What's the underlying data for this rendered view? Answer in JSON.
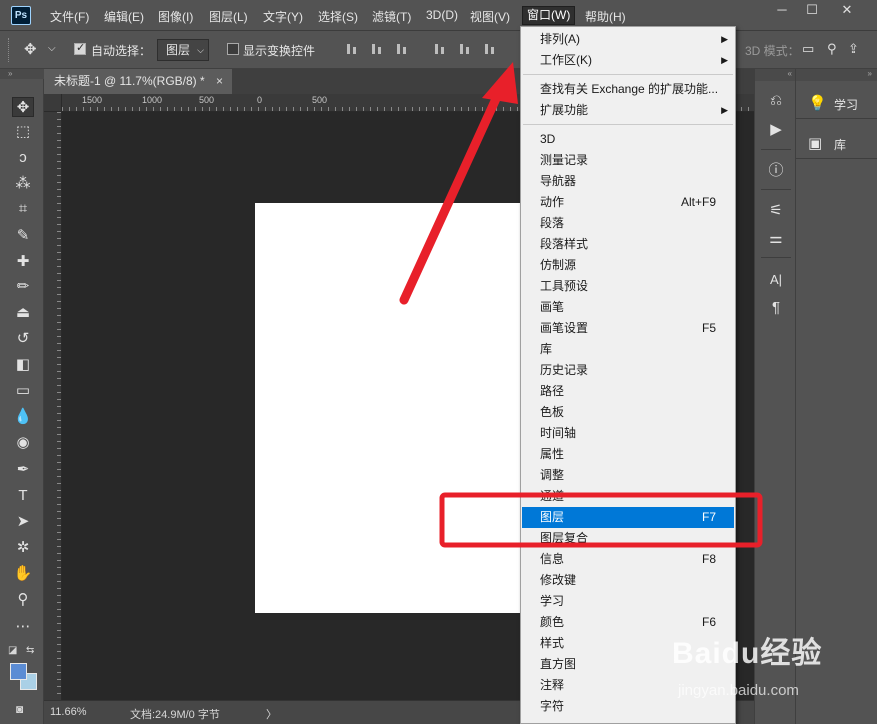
{
  "app": {
    "logo": "Ps",
    "menus": [
      "文件(F)",
      "编辑(E)",
      "图像(I)",
      "图层(L)",
      "文字(Y)",
      "选择(S)",
      "滤镜(T)",
      "3D(D)",
      "视图(V)",
      "窗口(W)",
      "帮助(H)"
    ],
    "active_menu": "窗口(W)",
    "window_controls": {
      "minimize": "─",
      "maximize": "☐",
      "close": "✕"
    }
  },
  "options_bar": {
    "move_icon": "✥",
    "auto_select_label": "自动选择：",
    "auto_select_checked": true,
    "auto_select_target": "图层",
    "show_transform_label": "显示变换控件",
    "show_transform_checked": false,
    "mode_3d_label": "3D 模式："
  },
  "tools": [
    {
      "name": "move-tool-icon",
      "glyph": "✥"
    },
    {
      "name": "marquee-tool-icon",
      "glyph": "⬚"
    },
    {
      "name": "lasso-tool-icon",
      "glyph": "ↄ"
    },
    {
      "name": "magic-wand-tool-icon",
      "glyph": "⁂"
    },
    {
      "name": "crop-tool-icon",
      "glyph": "⌗"
    },
    {
      "name": "eyedropper-tool-icon",
      "glyph": "✎"
    },
    {
      "name": "healing-brush-tool-icon",
      "glyph": "✚"
    },
    {
      "name": "brush-tool-icon",
      "glyph": "✏"
    },
    {
      "name": "stamp-tool-icon",
      "glyph": "⏏"
    },
    {
      "name": "history-brush-tool-icon",
      "glyph": "↺"
    },
    {
      "name": "eraser-tool-icon",
      "glyph": "◧"
    },
    {
      "name": "gradient-tool-icon",
      "glyph": "▭"
    },
    {
      "name": "blur-tool-icon",
      "glyph": "💧"
    },
    {
      "name": "dodge-tool-icon",
      "glyph": "◉"
    },
    {
      "name": "pen-tool-icon",
      "glyph": "✒"
    },
    {
      "name": "type-tool-icon",
      "glyph": "T"
    },
    {
      "name": "path-selection-tool-icon",
      "glyph": "➤"
    },
    {
      "name": "shape-tool-icon",
      "glyph": "✲"
    },
    {
      "name": "hand-tool-icon",
      "glyph": "✋"
    },
    {
      "name": "zoom-tool-icon",
      "glyph": "⚲"
    },
    {
      "name": "more-tools-icon",
      "glyph": "⋯"
    }
  ],
  "document": {
    "tab_title": "未标题-1 @ 11.7%(RGB/8) *",
    "tab_close": "×",
    "ruler_labels": [
      "1500",
      "1000",
      "500",
      "0",
      "500"
    ],
    "zoom": "11.66%",
    "doc_info": "文档:24.9M/0 字节",
    "status_arrow": "〉"
  },
  "right_strip": {
    "buttons": [
      {
        "name": "history-panel-icon",
        "glyph": "⎌"
      },
      {
        "name": "actions-panel-icon",
        "glyph": "▶"
      },
      {
        "name": "info-panel-icon",
        "glyph": "ⓘ"
      },
      {
        "name": "brush-settings-panel-icon",
        "glyph": "⚟"
      },
      {
        "name": "adjustments-panel-icon",
        "glyph": "⚌"
      },
      {
        "name": "character-panel-icon",
        "glyph": "A|"
      },
      {
        "name": "paragraph-panel-icon",
        "glyph": "¶"
      }
    ]
  },
  "right_panel": {
    "items": [
      {
        "name": "learn",
        "icon": "💡",
        "label": "学习"
      },
      {
        "name": "libraries",
        "icon": "▣",
        "label": "库"
      }
    ]
  },
  "window_menu": {
    "items": [
      {
        "label": "排列(A)",
        "shortcut": "",
        "submenu": true
      },
      {
        "label": "工作区(K)",
        "shortcut": "",
        "submenu": true
      },
      {
        "sep": true
      },
      {
        "label": "查找有关 Exchange 的扩展功能...",
        "shortcut": "",
        "submenu": false
      },
      {
        "label": "扩展功能",
        "shortcut": "",
        "submenu": true
      },
      {
        "sep": true
      },
      {
        "label": "3D",
        "shortcut": ""
      },
      {
        "label": "测量记录",
        "shortcut": ""
      },
      {
        "label": "导航器",
        "shortcut": ""
      },
      {
        "label": "动作",
        "shortcut": "Alt+F9"
      },
      {
        "label": "段落",
        "shortcut": ""
      },
      {
        "label": "段落样式",
        "shortcut": ""
      },
      {
        "label": "仿制源",
        "shortcut": ""
      },
      {
        "label": "工具预设",
        "shortcut": ""
      },
      {
        "label": "画笔",
        "shortcut": ""
      },
      {
        "label": "画笔设置",
        "shortcut": "F5"
      },
      {
        "label": "库",
        "shortcut": ""
      },
      {
        "label": "历史记录",
        "shortcut": ""
      },
      {
        "label": "路径",
        "shortcut": ""
      },
      {
        "label": "色板",
        "shortcut": ""
      },
      {
        "label": "时间轴",
        "shortcut": ""
      },
      {
        "label": "属性",
        "shortcut": ""
      },
      {
        "label": "调整",
        "shortcut": ""
      },
      {
        "label": "通道",
        "shortcut": ""
      },
      {
        "label": "图层",
        "shortcut": "F7",
        "highlight": true
      },
      {
        "label": "图层复合",
        "shortcut": ""
      },
      {
        "label": "信息",
        "shortcut": "F8"
      },
      {
        "label": "修改键",
        "shortcut": ""
      },
      {
        "label": "学习",
        "shortcut": ""
      },
      {
        "label": "颜色",
        "shortcut": "F6"
      },
      {
        "label": "样式",
        "shortcut": ""
      },
      {
        "label": "直方图",
        "shortcut": ""
      },
      {
        "label": "注释",
        "shortcut": ""
      },
      {
        "label": "字符",
        "shortcut": ""
      }
    ]
  },
  "annotations": {
    "arrow_color": "#e8202a",
    "box_color": "#e8202a"
  },
  "watermark": {
    "brand": "Baidu经验",
    "url": "jingyan.baidu.com"
  },
  "colors": {
    "foreground": "#5b8cd4",
    "background": "#aad0e6",
    "highlight": "#0078d7"
  }
}
